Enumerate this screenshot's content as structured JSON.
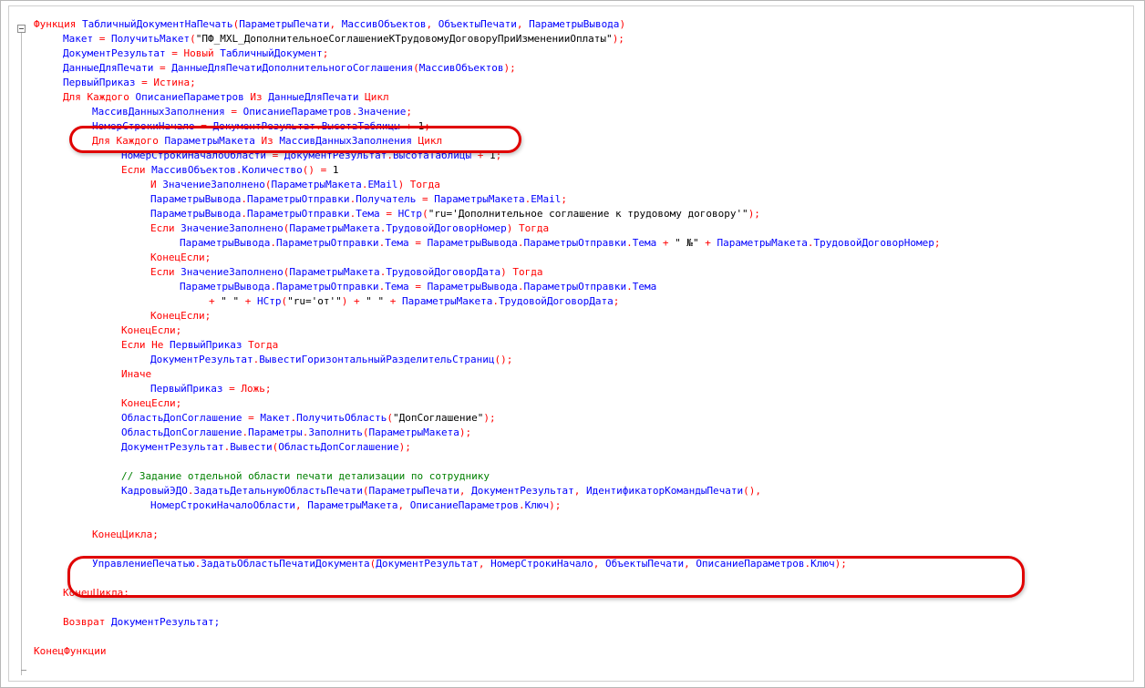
{
  "editor": {
    "lines": [
      {
        "parts": [
          {
            "t": "Функция ",
            "c": "kw"
          },
          {
            "t": "ТабличныйДокументНаПечать",
            "c": "id"
          },
          {
            "t": "(",
            "c": "kw"
          },
          {
            "t": "ПараметрыПечати",
            "c": "id"
          },
          {
            "t": ", ",
            "c": "kw"
          },
          {
            "t": "МассивОбъектов",
            "c": "id"
          },
          {
            "t": ", ",
            "c": "kw"
          },
          {
            "t": "ОбъектыПечати",
            "c": "id"
          },
          {
            "t": ", ",
            "c": "kw"
          },
          {
            "t": "ПараметрыВывода",
            "c": "id"
          },
          {
            "t": ")",
            "c": "kw"
          }
        ]
      },
      {
        "parts": [
          {
            "t": "Макет ",
            "c": "id"
          },
          {
            "t": "= ",
            "c": "kw"
          },
          {
            "t": "ПолучитьМакет",
            "c": "id"
          },
          {
            "t": "(",
            "c": "kw"
          },
          {
            "t": "\"ПФ_MXL_ДополнительноеСоглашениеКТрудовомуДоговоруПриИзмененииОплаты\"",
            "c": "str"
          },
          {
            "t": ");",
            "c": "kw"
          }
        ]
      },
      {
        "parts": [
          {
            "t": "ДокументРезультат ",
            "c": "id"
          },
          {
            "t": "= Новый ",
            "c": "kw"
          },
          {
            "t": "ТабличныйДокумент",
            "c": "id"
          },
          {
            "t": ";",
            "c": "kw"
          }
        ]
      },
      {
        "parts": [
          {
            "t": "ДанныеДляПечати ",
            "c": "id"
          },
          {
            "t": "= ",
            "c": "kw"
          },
          {
            "t": "ДанныеДляПечатиДополнительногоСоглашения",
            "c": "id"
          },
          {
            "t": "(",
            "c": "kw"
          },
          {
            "t": "МассивОбъектов",
            "c": "id"
          },
          {
            "t": ");",
            "c": "kw"
          }
        ]
      },
      {
        "parts": [
          {
            "t": "ПервыйПриказ ",
            "c": "id"
          },
          {
            "t": "= Истина;",
            "c": "kw"
          }
        ]
      },
      {
        "parts": [
          {
            "t": "Для Каждого ",
            "c": "kw"
          },
          {
            "t": "ОписаниеПараметров ",
            "c": "id"
          },
          {
            "t": "Из ",
            "c": "kw"
          },
          {
            "t": "ДанныеДляПечати ",
            "c": "id"
          },
          {
            "t": "Цикл",
            "c": "kw"
          }
        ]
      },
      {
        "parts": [
          {
            "t": "МассивДанныхЗаполнения ",
            "c": "id"
          },
          {
            "t": "= ",
            "c": "kw"
          },
          {
            "t": "ОписаниеПараметров",
            "c": "id"
          },
          {
            "t": ".",
            "c": "kw"
          },
          {
            "t": "Значение",
            "c": "id"
          },
          {
            "t": ";",
            "c": "kw"
          }
        ]
      },
      {
        "parts": [
          {
            "t": "НомерСтрокиНачало ",
            "c": "id"
          },
          {
            "t": "= ",
            "c": "kw"
          },
          {
            "t": "ДокументРезультат",
            "c": "id"
          },
          {
            "t": ".",
            "c": "kw"
          },
          {
            "t": "ВысотаТаблицы ",
            "c": "id"
          },
          {
            "t": "+ ",
            "c": "kw"
          },
          {
            "t": "1",
            "c": "str"
          },
          {
            "t": ";",
            "c": "kw"
          }
        ]
      },
      {
        "parts": [
          {
            "t": "Для Каждого ",
            "c": "kw"
          },
          {
            "t": "ПараметрыМакета ",
            "c": "id"
          },
          {
            "t": "Из ",
            "c": "kw"
          },
          {
            "t": "МассивДанныхЗаполнения ",
            "c": "id"
          },
          {
            "t": "Цикл",
            "c": "kw"
          }
        ]
      },
      {
        "parts": [
          {
            "t": "НомерСтрокиНачалоОбласти ",
            "c": "id"
          },
          {
            "t": "= ",
            "c": "kw"
          },
          {
            "t": "ДокументРезультат",
            "c": "id"
          },
          {
            "t": ".",
            "c": "kw"
          },
          {
            "t": "ВысотаТаблицы ",
            "c": "id"
          },
          {
            "t": "+ ",
            "c": "kw"
          },
          {
            "t": "1",
            "c": "str"
          },
          {
            "t": ";",
            "c": "kw"
          }
        ]
      },
      {
        "parts": [
          {
            "t": "Если ",
            "c": "kw"
          },
          {
            "t": "МассивОбъектов",
            "c": "id"
          },
          {
            "t": ".",
            "c": "kw"
          },
          {
            "t": "Количество",
            "c": "id"
          },
          {
            "t": "() = ",
            "c": "kw"
          },
          {
            "t": "1",
            "c": "str"
          }
        ]
      },
      {
        "parts": [
          {
            "t": "И ",
            "c": "kw"
          },
          {
            "t": "ЗначениеЗаполнено",
            "c": "id"
          },
          {
            "t": "(",
            "c": "kw"
          },
          {
            "t": "ПараметрыМакета",
            "c": "id"
          },
          {
            "t": ".",
            "c": "kw"
          },
          {
            "t": "EMail",
            "c": "id"
          },
          {
            "t": ") Тогда",
            "c": "kw"
          }
        ]
      },
      {
        "parts": [
          {
            "t": "ПараметрыВывода",
            "c": "id"
          },
          {
            "t": ".",
            "c": "kw"
          },
          {
            "t": "ПараметрыОтправки",
            "c": "id"
          },
          {
            "t": ".",
            "c": "kw"
          },
          {
            "t": "Получатель ",
            "c": "id"
          },
          {
            "t": "= ",
            "c": "kw"
          },
          {
            "t": "ПараметрыМакета",
            "c": "id"
          },
          {
            "t": ".",
            "c": "kw"
          },
          {
            "t": "EMail",
            "c": "id"
          },
          {
            "t": ";",
            "c": "kw"
          }
        ]
      },
      {
        "parts": [
          {
            "t": "ПараметрыВывода",
            "c": "id"
          },
          {
            "t": ".",
            "c": "kw"
          },
          {
            "t": "ПараметрыОтправки",
            "c": "id"
          },
          {
            "t": ".",
            "c": "kw"
          },
          {
            "t": "Тема ",
            "c": "id"
          },
          {
            "t": "= ",
            "c": "kw"
          },
          {
            "t": "НСтр",
            "c": "id"
          },
          {
            "t": "(",
            "c": "kw"
          },
          {
            "t": "\"ru='Дополнительное соглашение к трудовому договору'\"",
            "c": "str"
          },
          {
            "t": ");",
            "c": "kw"
          }
        ]
      },
      {
        "parts": [
          {
            "t": "Если ",
            "c": "kw"
          },
          {
            "t": "ЗначениеЗаполнено",
            "c": "id"
          },
          {
            "t": "(",
            "c": "kw"
          },
          {
            "t": "ПараметрыМакета",
            "c": "id"
          },
          {
            "t": ".",
            "c": "kw"
          },
          {
            "t": "ТрудовойДоговорНомер",
            "c": "id"
          },
          {
            "t": ") Тогда",
            "c": "kw"
          }
        ]
      },
      {
        "parts": [
          {
            "t": "ПараметрыВывода",
            "c": "id"
          },
          {
            "t": ".",
            "c": "kw"
          },
          {
            "t": "ПараметрыОтправки",
            "c": "id"
          },
          {
            "t": ".",
            "c": "kw"
          },
          {
            "t": "Тема ",
            "c": "id"
          },
          {
            "t": "= ",
            "c": "kw"
          },
          {
            "t": "ПараметрыВывода",
            "c": "id"
          },
          {
            "t": ".",
            "c": "kw"
          },
          {
            "t": "ПараметрыОтправки",
            "c": "id"
          },
          {
            "t": ".",
            "c": "kw"
          },
          {
            "t": "Тема ",
            "c": "id"
          },
          {
            "t": "+ ",
            "c": "kw"
          },
          {
            "t": "\" №\" ",
            "c": "str"
          },
          {
            "t": "+ ",
            "c": "kw"
          },
          {
            "t": "ПараметрыМакета",
            "c": "id"
          },
          {
            "t": ".",
            "c": "kw"
          },
          {
            "t": "ТрудовойДоговорНомер",
            "c": "id"
          },
          {
            "t": ";",
            "c": "kw"
          }
        ]
      },
      {
        "parts": [
          {
            "t": "КонецЕсли;",
            "c": "kw"
          }
        ]
      },
      {
        "parts": [
          {
            "t": "Если ",
            "c": "kw"
          },
          {
            "t": "ЗначениеЗаполнено",
            "c": "id"
          },
          {
            "t": "(",
            "c": "kw"
          },
          {
            "t": "ПараметрыМакета",
            "c": "id"
          },
          {
            "t": ".",
            "c": "kw"
          },
          {
            "t": "ТрудовойДоговорДата",
            "c": "id"
          },
          {
            "t": ") Тогда",
            "c": "kw"
          }
        ]
      },
      {
        "parts": [
          {
            "t": "ПараметрыВывода",
            "c": "id"
          },
          {
            "t": ".",
            "c": "kw"
          },
          {
            "t": "ПараметрыОтправки",
            "c": "id"
          },
          {
            "t": ".",
            "c": "kw"
          },
          {
            "t": "Тема ",
            "c": "id"
          },
          {
            "t": "= ",
            "c": "kw"
          },
          {
            "t": "ПараметрыВывода",
            "c": "id"
          },
          {
            "t": ".",
            "c": "kw"
          },
          {
            "t": "ПараметрыОтправки",
            "c": "id"
          },
          {
            "t": ".",
            "c": "kw"
          },
          {
            "t": "Тема",
            "c": "id"
          }
        ]
      },
      {
        "parts": [
          {
            "t": "+ ",
            "c": "kw"
          },
          {
            "t": "\" \" ",
            "c": "str"
          },
          {
            "t": "+ ",
            "c": "kw"
          },
          {
            "t": "НСтр",
            "c": "id"
          },
          {
            "t": "(",
            "c": "kw"
          },
          {
            "t": "\"ru='от'\"",
            "c": "str"
          },
          {
            "t": ") + ",
            "c": "kw"
          },
          {
            "t": "\" \" ",
            "c": "str"
          },
          {
            "t": "+ ",
            "c": "kw"
          },
          {
            "t": "ПараметрыМакета",
            "c": "id"
          },
          {
            "t": ".",
            "c": "kw"
          },
          {
            "t": "ТрудовойДоговорДата",
            "c": "id"
          },
          {
            "t": ";",
            "c": "kw"
          }
        ]
      },
      {
        "parts": [
          {
            "t": "КонецЕсли;",
            "c": "kw"
          }
        ]
      },
      {
        "parts": [
          {
            "t": "КонецЕсли;",
            "c": "kw"
          }
        ]
      },
      {
        "parts": [
          {
            "t": "Если Не ",
            "c": "kw"
          },
          {
            "t": "ПервыйПриказ ",
            "c": "id"
          },
          {
            "t": "Тогда",
            "c": "kw"
          }
        ]
      },
      {
        "parts": [
          {
            "t": "ДокументРезультат",
            "c": "id"
          },
          {
            "t": ".",
            "c": "kw"
          },
          {
            "t": "ВывестиГоризонтальныйРазделительСтраниц",
            "c": "id"
          },
          {
            "t": "();",
            "c": "kw"
          }
        ]
      },
      {
        "parts": [
          {
            "t": "Иначе",
            "c": "kw"
          }
        ]
      },
      {
        "parts": [
          {
            "t": "ПервыйПриказ ",
            "c": "id"
          },
          {
            "t": "= Ложь;",
            "c": "kw"
          }
        ]
      },
      {
        "parts": [
          {
            "t": "КонецЕсли;",
            "c": "kw"
          }
        ]
      },
      {
        "parts": [
          {
            "t": "ОбластьДопСоглашение ",
            "c": "id"
          },
          {
            "t": "= ",
            "c": "kw"
          },
          {
            "t": "Макет",
            "c": "id"
          },
          {
            "t": ".",
            "c": "kw"
          },
          {
            "t": "ПолучитьОбласть",
            "c": "id"
          },
          {
            "t": "(",
            "c": "kw"
          },
          {
            "t": "\"ДопСоглашение\"",
            "c": "str"
          },
          {
            "t": ");",
            "c": "kw"
          }
        ]
      },
      {
        "parts": [
          {
            "t": "ОбластьДопСоглашение",
            "c": "id"
          },
          {
            "t": ".",
            "c": "kw"
          },
          {
            "t": "Параметры",
            "c": "id"
          },
          {
            "t": ".",
            "c": "kw"
          },
          {
            "t": "Заполнить",
            "c": "id"
          },
          {
            "t": "(",
            "c": "kw"
          },
          {
            "t": "ПараметрыМакета",
            "c": "id"
          },
          {
            "t": ");",
            "c": "kw"
          }
        ]
      },
      {
        "parts": [
          {
            "t": "ДокументРезультат",
            "c": "id"
          },
          {
            "t": ".",
            "c": "kw"
          },
          {
            "t": "Вывести",
            "c": "id"
          },
          {
            "t": "(",
            "c": "kw"
          },
          {
            "t": "ОбластьДопСоглашение",
            "c": "id"
          },
          {
            "t": ");",
            "c": "kw"
          }
        ]
      },
      {
        "parts": []
      },
      {
        "parts": [
          {
            "t": "// Задание отдельной области печати детализации по сотруднику",
            "c": "cm"
          }
        ]
      },
      {
        "parts": [
          {
            "t": "КадровыйЭДО",
            "c": "id"
          },
          {
            "t": ".",
            "c": "kw"
          },
          {
            "t": "ЗадатьДетальнуюОбластьПечати",
            "c": "id"
          },
          {
            "t": "(",
            "c": "kw"
          },
          {
            "t": "ПараметрыПечати",
            "c": "id"
          },
          {
            "t": ", ",
            "c": "kw"
          },
          {
            "t": "ДокументРезультат",
            "c": "id"
          },
          {
            "t": ", ",
            "c": "kw"
          },
          {
            "t": "ИдентификаторКомандыПечати",
            "c": "id"
          },
          {
            "t": "(),",
            "c": "kw"
          }
        ]
      },
      {
        "parts": [
          {
            "t": "НомерСтрокиНачалоОбласти",
            "c": "id"
          },
          {
            "t": ", ",
            "c": "kw"
          },
          {
            "t": "ПараметрыМакета",
            "c": "id"
          },
          {
            "t": ", ",
            "c": "kw"
          },
          {
            "t": "ОписаниеПараметров",
            "c": "id"
          },
          {
            "t": ".",
            "c": "kw"
          },
          {
            "t": "Ключ",
            "c": "id"
          },
          {
            "t": ");",
            "c": "kw"
          }
        ]
      },
      {
        "parts": []
      },
      {
        "parts": [
          {
            "t": "КонецЦикла;",
            "c": "kw"
          }
        ]
      },
      {
        "parts": []
      },
      {
        "parts": [
          {
            "t": "УправлениеПечатью",
            "c": "id"
          },
          {
            "t": ".",
            "c": "kw"
          },
          {
            "t": "ЗадатьОбластьПечатиДокумента",
            "c": "id"
          },
          {
            "t": "(",
            "c": "kw"
          },
          {
            "t": "ДокументРезультат",
            "c": "id"
          },
          {
            "t": ", ",
            "c": "kw"
          },
          {
            "t": "НомерСтрокиНачало",
            "c": "id"
          },
          {
            "t": ", ",
            "c": "kw"
          },
          {
            "t": "ОбъектыПечати",
            "c": "id"
          },
          {
            "t": ", ",
            "c": "kw"
          },
          {
            "t": "ОписаниеПараметров",
            "c": "id"
          },
          {
            "t": ".",
            "c": "kw"
          },
          {
            "t": "Ключ",
            "c": "id"
          },
          {
            "t": ");",
            "c": "kw"
          }
        ]
      },
      {
        "parts": []
      },
      {
        "parts": [
          {
            "t": "КонецЦикла;",
            "c": "kw"
          }
        ]
      },
      {
        "parts": []
      },
      {
        "parts": [
          {
            "t": "Возврат ",
            "c": "kw"
          },
          {
            "t": "ДокументРезультат;",
            "c": "id"
          }
        ]
      },
      {
        "parts": []
      },
      {
        "parts": [
          {
            "t": "КонецФункции",
            "c": "kw"
          }
        ]
      }
    ]
  }
}
